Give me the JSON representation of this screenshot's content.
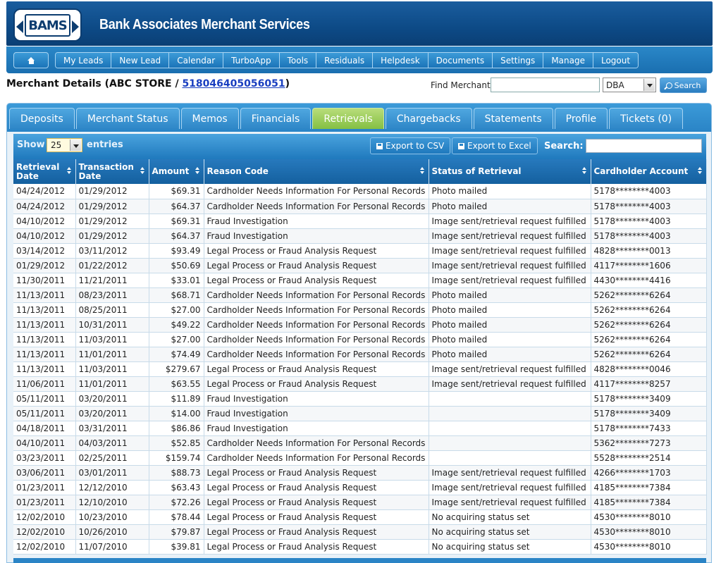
{
  "header": {
    "logo_text": "BAMS",
    "brand": "Bank Associates Merchant Services"
  },
  "nav": {
    "items": [
      "My Leads",
      "New Lead",
      "Calendar",
      "TurboApp",
      "Tools",
      "Residuals",
      "Helpdesk",
      "Documents",
      "Settings",
      "Manage",
      "Logout"
    ]
  },
  "merchant": {
    "title_prefix": "Merchant Details (ABC STORE / ",
    "merchant_id": "518046405056051",
    "title_suffix": ")"
  },
  "find": {
    "label": "Find Merchant:",
    "value": "",
    "select_value": "DBA",
    "search_label": "Search"
  },
  "tabs": [
    {
      "label": "Deposits",
      "active": false
    },
    {
      "label": "Merchant Status",
      "active": false
    },
    {
      "label": "Memos",
      "active": false
    },
    {
      "label": "Financials",
      "active": false
    },
    {
      "label": "Retrievals",
      "active": true
    },
    {
      "label": "Chargebacks",
      "active": false
    },
    {
      "label": "Statements",
      "active": false
    },
    {
      "label": "Profile",
      "active": false
    },
    {
      "label": "Tickets (0)",
      "active": false
    }
  ],
  "toolbar": {
    "show_label": "Show",
    "show_value": "25",
    "entries_label": "entries",
    "export_csv": "Export to CSV",
    "export_excel": "Export to Excel",
    "search_label": "Search:",
    "search_value": ""
  },
  "table": {
    "headers": [
      "Retrieval Date",
      "Transaction Date",
      "Amount",
      "Reason Code",
      "Status of Retrieval",
      "Cardholder Account"
    ],
    "rows": [
      [
        "04/24/2012",
        "01/29/2012",
        "$69.31",
        "Cardholder Needs Information For Personal Records",
        "Photo mailed",
        "5178********4003"
      ],
      [
        "04/24/2012",
        "01/29/2012",
        "$64.37",
        "Cardholder Needs Information For Personal Records",
        "Photo mailed",
        "5178********4003"
      ],
      [
        "04/10/2012",
        "01/29/2012",
        "$69.31",
        "Fraud Investigation",
        "Image sent/retrieval request fulfilled",
        "5178********4003"
      ],
      [
        "04/10/2012",
        "01/29/2012",
        "$64.37",
        "Fraud Investigation",
        "Image sent/retrieval request fulfilled",
        "5178********4003"
      ],
      [
        "03/14/2012",
        "03/11/2012",
        "$93.49",
        "Legal Process or Fraud Analysis Request",
        "Image sent/retrieval request fulfilled",
        "4828********0013"
      ],
      [
        "01/29/2012",
        "01/22/2012",
        "$50.69",
        "Legal Process or Fraud Analysis Request",
        "Image sent/retrieval request fulfilled",
        "4117********1606"
      ],
      [
        "11/30/2011",
        "11/21/2011",
        "$33.01",
        "Legal Process or Fraud Analysis Request",
        "Image sent/retrieval request fulfilled",
        "4430********4416"
      ],
      [
        "11/13/2011",
        "08/23/2011",
        "$68.71",
        "Cardholder Needs Information For Personal Records",
        "Photo mailed",
        "5262********6264"
      ],
      [
        "11/13/2011",
        "08/25/2011",
        "$27.00",
        "Cardholder Needs Information For Personal Records",
        "Photo mailed",
        "5262********6264"
      ],
      [
        "11/13/2011",
        "10/31/2011",
        "$49.22",
        "Cardholder Needs Information For Personal Records",
        "Photo mailed",
        "5262********6264"
      ],
      [
        "11/13/2011",
        "11/03/2011",
        "$27.00",
        "Cardholder Needs Information For Personal Records",
        "Photo mailed",
        "5262********6264"
      ],
      [
        "11/13/2011",
        "11/01/2011",
        "$74.49",
        "Cardholder Needs Information For Personal Records",
        "Photo mailed",
        "5262********6264"
      ],
      [
        "11/13/2011",
        "11/03/2011",
        "$279.67",
        "Legal Process or Fraud Analysis Request",
        "Image sent/retrieval request fulfilled",
        "4828********0046"
      ],
      [
        "11/06/2011",
        "11/01/2011",
        "$63.55",
        "Legal Process or Fraud Analysis Request",
        "Image sent/retrieval request fulfilled",
        "4117********8257"
      ],
      [
        "05/11/2011",
        "03/20/2011",
        "$11.89",
        "Fraud Investigation",
        "",
        "5178********3409"
      ],
      [
        "05/11/2011",
        "03/20/2011",
        "$14.00",
        "Fraud Investigation",
        "",
        "5178********3409"
      ],
      [
        "04/18/2011",
        "03/31/2011",
        "$86.86",
        "Fraud Investigation",
        "",
        "5178********7433"
      ],
      [
        "04/10/2011",
        "04/03/2011",
        "$52.85",
        "Cardholder Needs Information For Personal Records",
        "",
        "5362********7273"
      ],
      [
        "03/23/2011",
        "02/25/2011",
        "$159.74",
        "Cardholder Needs Information For Personal Records",
        "",
        "5528********2514"
      ],
      [
        "03/06/2011",
        "03/01/2011",
        "$88.73",
        "Legal Process or Fraud Analysis Request",
        "Image sent/retrieval request fulfilled",
        "4266********1703"
      ],
      [
        "01/23/2011",
        "12/12/2010",
        "$63.43",
        "Legal Process or Fraud Analysis Request",
        "Image sent/retrieval request fulfilled",
        "4185********7384"
      ],
      [
        "01/23/2011",
        "12/10/2010",
        "$72.26",
        "Legal Process or Fraud Analysis Request",
        "Image sent/retrieval request fulfilled",
        "4185********7384"
      ],
      [
        "12/02/2010",
        "10/23/2010",
        "$78.44",
        "Legal Process or Fraud Analysis Request",
        "No acquiring status set",
        "4530********8010"
      ],
      [
        "12/02/2010",
        "10/26/2010",
        "$79.87",
        "Legal Process or Fraud Analysis Request",
        "No acquiring status set",
        "4530********8010"
      ],
      [
        "12/02/2010",
        "11/07/2010",
        "$39.81",
        "Legal Process or Fraud Analysis Request",
        "No acquiring status set",
        "4530********8010"
      ]
    ]
  }
}
